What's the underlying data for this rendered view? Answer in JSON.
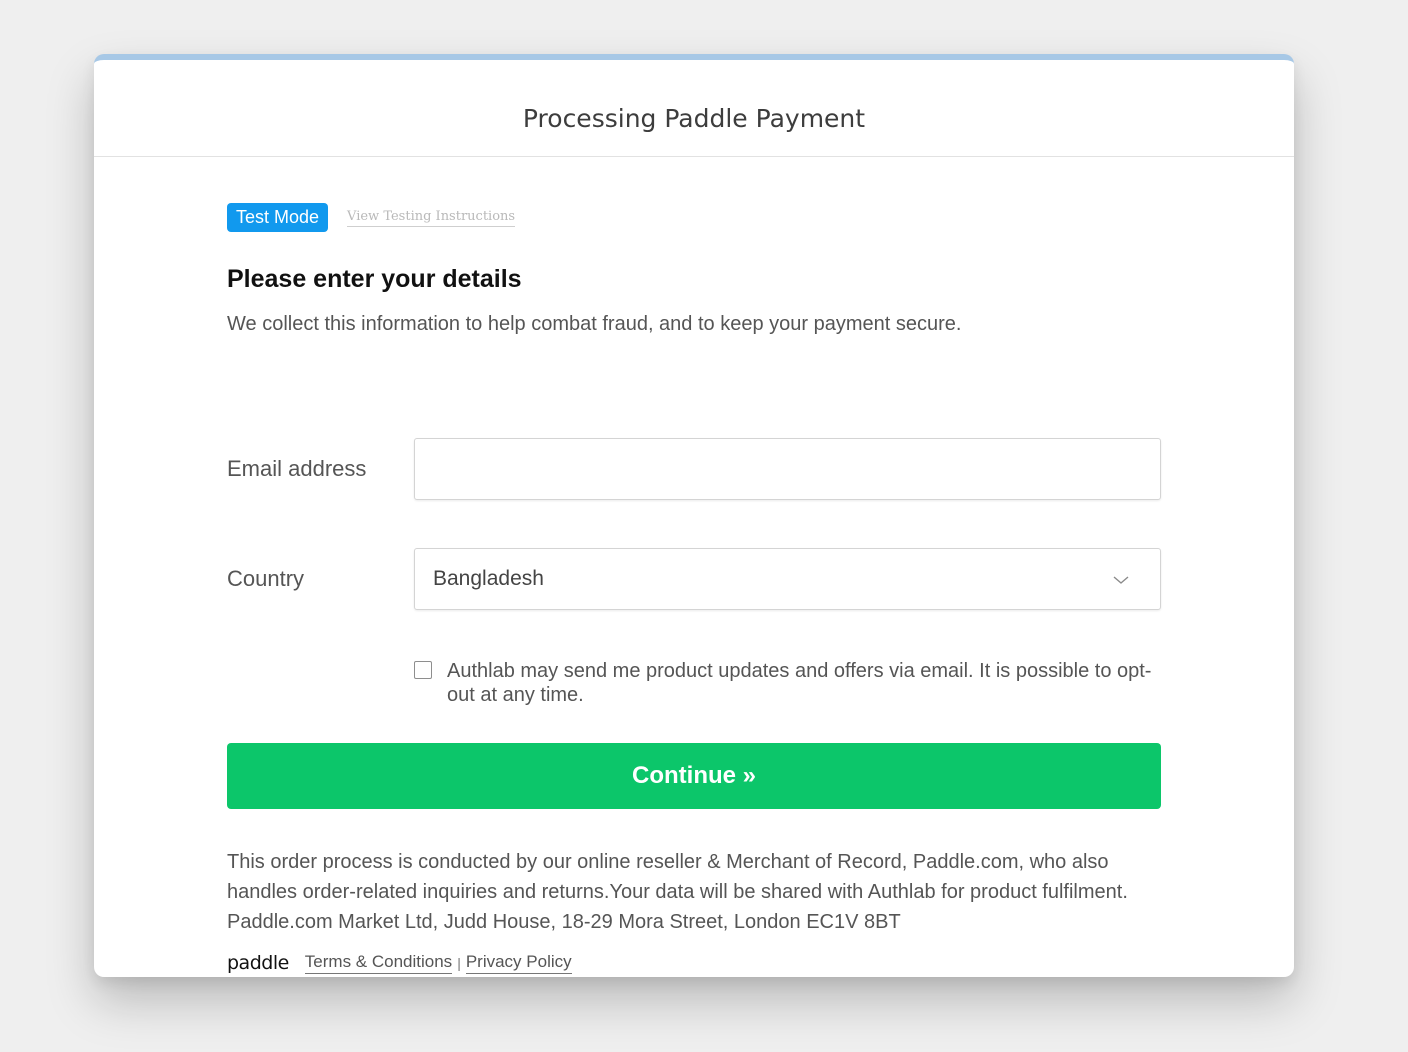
{
  "modal": {
    "title": "Processing Paddle Payment"
  },
  "test_mode": {
    "badge": "Test Mode",
    "instructions_link": "View Testing Instructions"
  },
  "form": {
    "heading": "Please enter your details",
    "subtext": "We collect this information to help combat fraud, and to keep your payment secure.",
    "email_label": "Email address",
    "email_value": "",
    "email_placeholder": "",
    "country_label": "Country",
    "country_value": "Bangladesh",
    "consent_text": "Authlab may send me product updates and offers via email. It is possible to opt-out at any time.",
    "consent_checked": false,
    "continue_label": "Continue »"
  },
  "legal": {
    "text": "This order process is conducted by our online reseller & Merchant of Record, Paddle.com, who also handles order-related inquiries and returns.Your data will be shared with Authlab for product fulfilment. Paddle.com Market Ltd, Judd House, 18-29 Mora Street, London EC1V 8BT"
  },
  "footer": {
    "logo_text": "paddle",
    "terms_label": "Terms & Conditions",
    "separator": "|",
    "privacy_label": "Privacy Policy"
  },
  "colors": {
    "accent_blue": "#1199ee",
    "continue_green": "#0cc66a",
    "top_border": "#a7c8e6"
  }
}
